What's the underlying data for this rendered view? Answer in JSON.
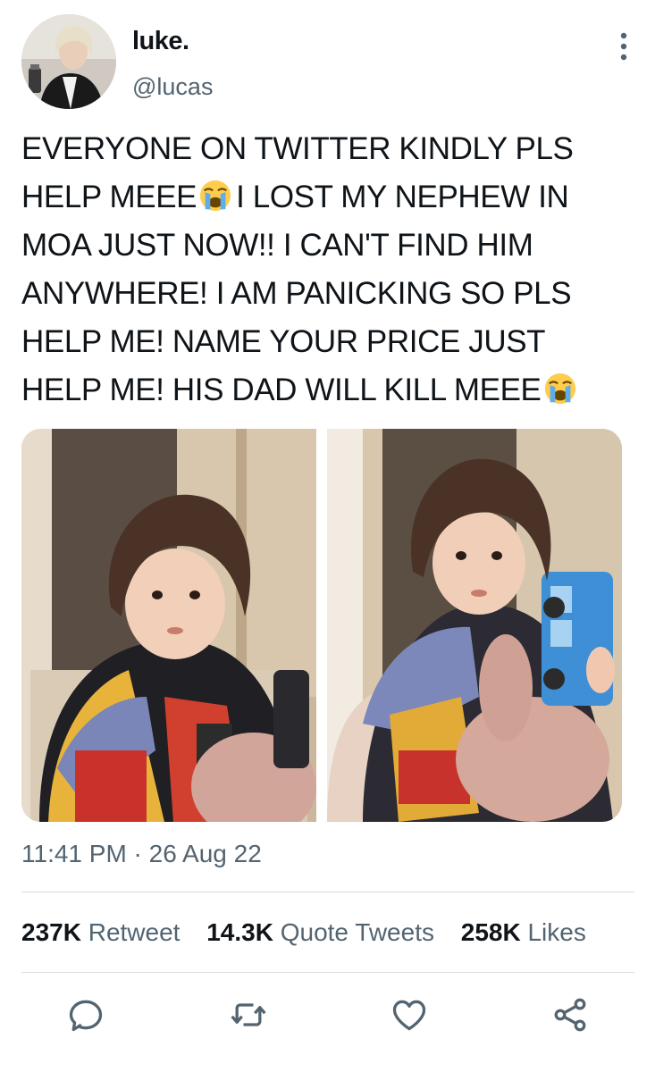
{
  "user": {
    "display_name": "luke.",
    "handle": "@lucas",
    "avatar": "avatar-photo"
  },
  "more_icon": "more-vertical-icon",
  "tweet": {
    "lines": [
      "EVERYONE ON TWITTER KINDLY PLS",
      "HELP MEEE",
      "I LOST MY NEPHEW IN",
      "MOA JUST NOW!! I CAN'T FIND HIM",
      "ANYWHERE! I AM PANICKING SO PLS",
      "HELP ME! NAME YOUR PRICE JUST",
      "HELP ME! HIS DAD WILL KILL MEEE"
    ],
    "emoji": "loudly-crying-face-emoji"
  },
  "media": {
    "photos": [
      "child-with-teddy-bear-photo",
      "child-holding-toy-bus-photo"
    ]
  },
  "timestamp": "11:41 PM · 26 Aug 22",
  "stats": {
    "retweets_count": "237K",
    "retweets_label": "Retweet",
    "quotes_count": "14.3K",
    "quotes_label": "Quote Tweets",
    "likes_count": "258K",
    "likes_label": "Likes"
  },
  "actions": [
    "reply-icon",
    "retweet-icon",
    "like-icon",
    "share-icon"
  ],
  "colors": {
    "text": "#0f1419",
    "secondary": "#536471",
    "divider": "#d6dde2",
    "icon": "#536471"
  }
}
